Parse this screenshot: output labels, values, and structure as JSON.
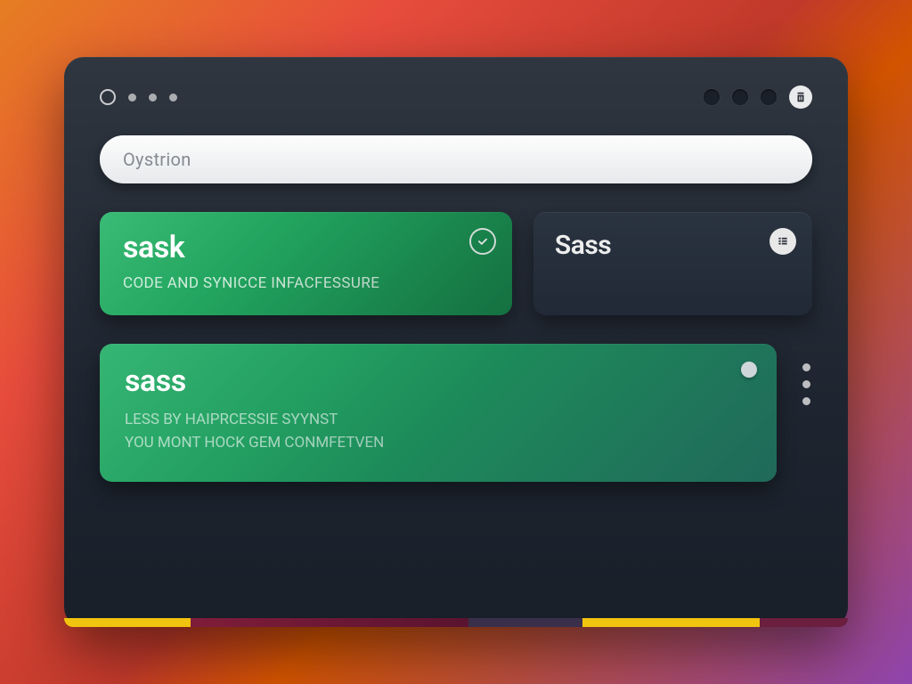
{
  "search": {
    "placeholder": "Oystrion"
  },
  "row1": {
    "primary": {
      "title": "sask",
      "subtitle": "CODE AND  SYNICCE INFACFESSURE"
    },
    "secondary": {
      "title": "Sass"
    }
  },
  "row2": {
    "title": "sass",
    "line1": "LESS BY  HAIPRCESSIE SYYNST",
    "line2": "YOU MONT HOCK  GEM CONMFETVEN"
  }
}
